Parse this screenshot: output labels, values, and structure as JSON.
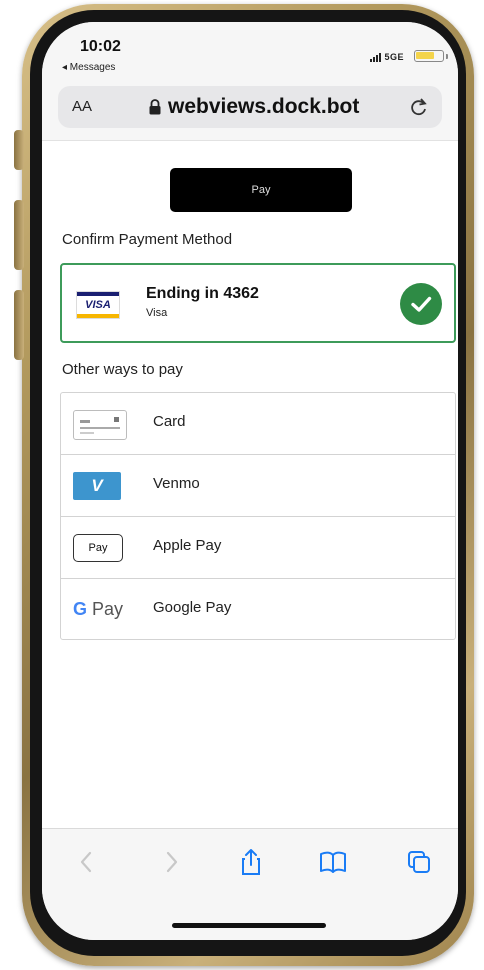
{
  "status_bar": {
    "time": "10:02",
    "back_app": "◂ Messages",
    "network": "5GE"
  },
  "browser": {
    "text_size_button": "AA",
    "url": "webviews.dock.bot"
  },
  "content": {
    "pay_button": "Pay",
    "confirm_title": "Confirm Payment Method",
    "selected_method": {
      "logo_text": "VISA",
      "title": "Ending in 4362",
      "subtitle": "Visa",
      "status_color": "#2e8b45"
    },
    "other_title": "Other ways to pay",
    "methods": [
      {
        "label": "Card",
        "icon": "card-icon"
      },
      {
        "label": "Venmo",
        "icon": "venmo-icon",
        "icon_text": "V",
        "color": "#3d95ce"
      },
      {
        "label": "Apple Pay",
        "icon": "apple-pay-icon",
        "icon_text": "Pay"
      },
      {
        "label": "Google Pay",
        "icon": "google-pay-icon",
        "icon_text": "Pay",
        "icon_letter": "G"
      }
    ]
  },
  "toolbar": {
    "buttons": [
      "back",
      "forward",
      "share",
      "bookmarks",
      "tabs"
    ]
  }
}
